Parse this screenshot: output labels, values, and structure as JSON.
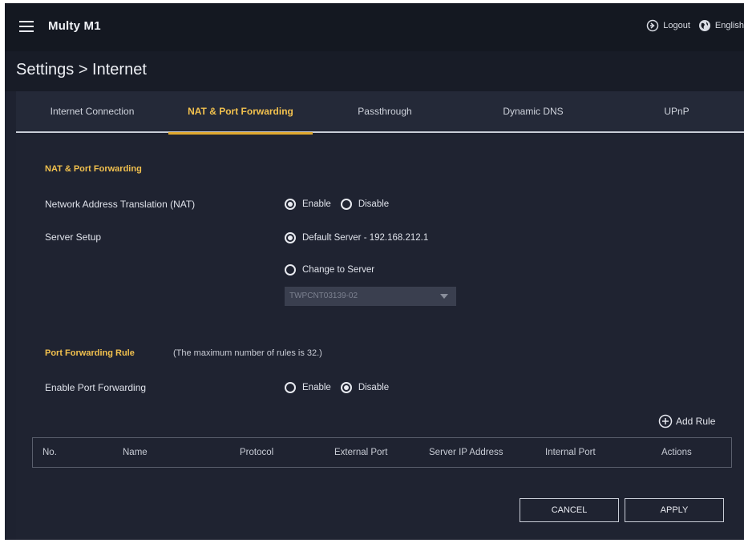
{
  "header": {
    "brand": "Multy M1",
    "logout_label": "Logout",
    "language_label": "English"
  },
  "breadcrumb": "Settings > Internet",
  "tabs": [
    {
      "label": "Internet Connection"
    },
    {
      "label": "NAT & Port Forwarding",
      "active": true
    },
    {
      "label": "Passthrough"
    },
    {
      "label": "Dynamic DNS"
    },
    {
      "label": "UPnP"
    }
  ],
  "nat": {
    "section_title": "NAT & Port Forwarding",
    "nat_label": "Network Address Translation (NAT)",
    "enable_label": "Enable",
    "disable_label": "Disable",
    "nat_value": "Enable",
    "server_setup_label": "Server Setup",
    "default_server_label": "Default Server - 192.168.212.1",
    "change_server_label": "Change to Server",
    "server_setup_value": "Default Server",
    "server_select_value": "TWPCNT03139-02"
  },
  "port_forwarding": {
    "section_title": "Port Forwarding Rule",
    "note": "(The maximum number of rules is 32.)",
    "enable_pf_label": "Enable Port Forwarding",
    "enable_label": "Enable",
    "disable_label": "Disable",
    "pf_value": "Disable",
    "add_rule_label": "Add Rule",
    "columns": [
      "No.",
      "Name",
      "Protocol",
      "External Port",
      "Server IP Address",
      "Internal Port",
      "Actions"
    ]
  },
  "actions": {
    "cancel_label": "CANCEL",
    "apply_label": "APPLY"
  },
  "colors": {
    "accent": "#f2c14e",
    "background": "#1e2230",
    "topbar": "#141821"
  }
}
